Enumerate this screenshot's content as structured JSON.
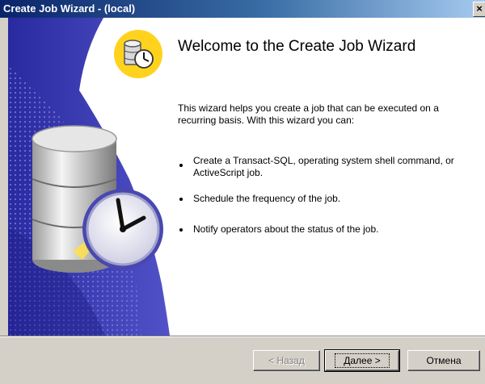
{
  "window": {
    "title": "Create Job Wizard - (local)",
    "close_label": "×"
  },
  "wizard": {
    "heading": "Welcome to the Create Job Wizard",
    "intro": "This wizard helps you create a job that can be executed on a recurring basis. With this wizard you can:",
    "bullets": [
      "Create a Transact-SQL, operating system shell command, or ActiveScript job.",
      "Schedule the frequency of the job.",
      "Notify operators about the status of the job."
    ],
    "icons": {
      "header": "job-clock-icon",
      "side": "database-clock-illustration"
    }
  },
  "buttons": {
    "back": "< Назад",
    "next": "Далее >",
    "cancel": "Отмена"
  },
  "colors": {
    "titlebar_start": "#0a246a",
    "titlebar_end": "#a6caf0",
    "side_panel": "#3c3cb4",
    "header_icon_bg": "#ffd21e",
    "dialog_face": "#d4d0c8"
  }
}
